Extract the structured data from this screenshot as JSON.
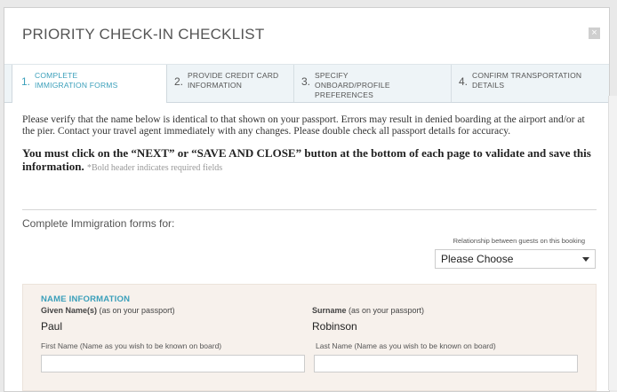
{
  "dialog": {
    "title": "PRIORITY CHECK-IN CHECKLIST",
    "close_glyph": "×"
  },
  "tabs": [
    {
      "num": "1.",
      "label": "COMPLETE IMMIGRATION FORMS",
      "active": true
    },
    {
      "num": "2.",
      "label": "PROVIDE CREDIT CARD INFORMATION",
      "active": false
    },
    {
      "num": "3.",
      "label": "SPECIFY ONBOARD/PROFILE PREFERENCES",
      "active": false
    },
    {
      "num": "4.",
      "label": "CONFIRM TRANSPORTATION DETAILS",
      "active": false
    }
  ],
  "intro": "Please verify that the name below is identical to that shown on your passport. Errors may result in denied boarding at the airport and/or at the pier. Contact your travel agent immediately with any changes. Please double check all passport details for accuracy.",
  "must_click": "You must click on the “NEXT” or “SAVE AND CLOSE” button at the bottom of each page to validate and save this information.",
  "required_note": "*Bold header indicates required fields",
  "complete_for": "Complete Immigration forms for:",
  "relationship": {
    "label": "Relationship between guests on this booking",
    "selected": "Please Choose"
  },
  "name_info": {
    "section_title": "NAME INFORMATION",
    "given_label_bold": "Given Name(s)",
    "given_label_rest": " (as on your passport)",
    "given_value": "Paul",
    "surname_label_bold": "Surname",
    "surname_label_rest": " (as on your passport)",
    "surname_value": "Robinson",
    "first_name_hint": "First Name (Name as you wish to be known on board)",
    "last_name_hint": "Last Name (Name as you wish to be known on board)",
    "first_name_value": "",
    "last_name_value": ""
  },
  "colors": {
    "accent": "#3a9fba",
    "panel_bg": "#f7f1ec",
    "tab_bar_bg": "#eef4f7"
  }
}
